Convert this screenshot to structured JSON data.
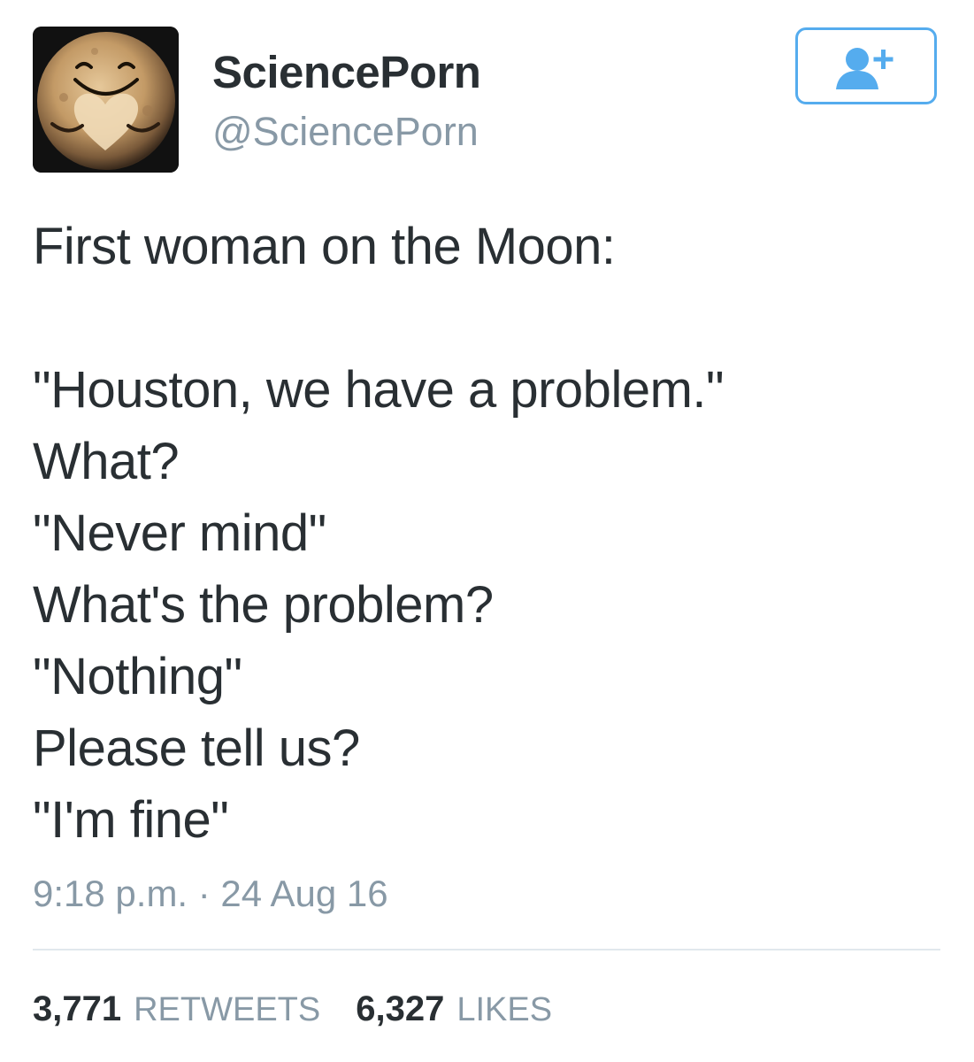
{
  "user": {
    "display_name": "SciencePorn",
    "handle": "@SciencePorn",
    "avatar_icon": "pluto-heart-icon"
  },
  "follow_button": {
    "icon": "follow-user-plus-icon",
    "accent_color": "#55acee"
  },
  "tweet": {
    "lines": [
      "First woman on the Moon:",
      "",
      "\"Houston, we have a problem.\"",
      "What?",
      "\"Never mind\"",
      "What's the problem?",
      "\"Nothing\"",
      "Please tell us?",
      "\"I'm fine\""
    ],
    "timestamp": "9:18 p.m. · 24 Aug 16"
  },
  "stats": {
    "retweets_count": "3,771",
    "retweets_label": "RETWEETS",
    "likes_count": "6,327",
    "likes_label": "LIKES"
  },
  "colors": {
    "text": "#292f33",
    "secondary": "#8899a6",
    "divider": "#e1e8ed"
  }
}
